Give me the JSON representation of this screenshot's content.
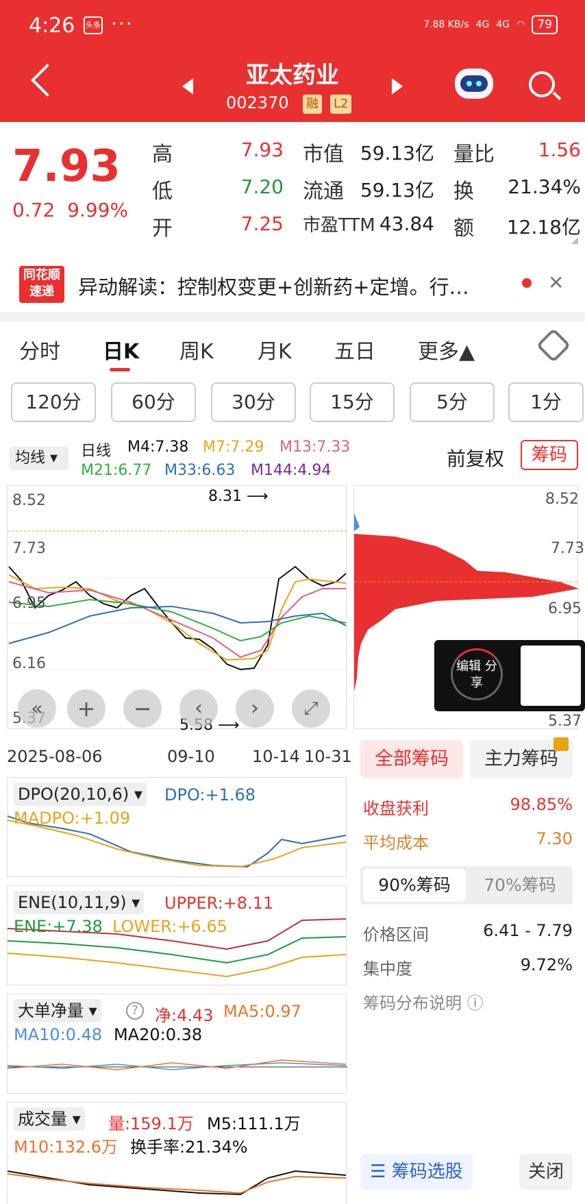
{
  "status_bar": {
    "time": "4:26",
    "app_icon": "头条",
    "dots": "···",
    "net_speed": "7.88 KB/s",
    "net1": "4G",
    "net2": "4G",
    "battery": "79"
  },
  "header": {
    "title": "亚太药业",
    "code": "002370",
    "tag_margin": "融",
    "tag_level": "L2"
  },
  "quote": {
    "price": "7.93",
    "change": "0.72",
    "change_pct": "9.99%",
    "high_label": "高",
    "high": "7.93",
    "low_label": "低",
    "low": "7.20",
    "open_label": "开",
    "open": "7.25",
    "mktcap_label": "市值",
    "mktcap": "59.13亿",
    "float_label": "流通",
    "float": "59.13亿",
    "pe_label": "市盈TTM",
    "pe": "43.84",
    "vol_ratio_label": "量比",
    "vol_ratio": "1.56",
    "turnover_label": "换",
    "turnover": "21.34%",
    "amount_label": "额",
    "amount": "12.18亿"
  },
  "news": {
    "logo": "同花顺 速递",
    "text": "异动解读：控制权变更+创新药+定增。行…"
  },
  "tabs": [
    "分时",
    "日K",
    "周K",
    "月K",
    "五日",
    "更多▲"
  ],
  "periods": [
    "120分",
    "60分",
    "30分",
    "15分",
    "5分",
    "1分"
  ],
  "ma": {
    "selector": "均线",
    "kind": "日线",
    "m4": "M4:7.38",
    "m7": "M7:7.29",
    "m13": "M13:7.33",
    "m21": "M21:6.77",
    "m33": "M33:6.63",
    "m144": "M144:4.94",
    "adjust": "前复权",
    "chips_btn": "筹码"
  },
  "kline": {
    "y_labels": [
      "8.52",
      "7.73",
      "6.95",
      "6.16",
      "5.37"
    ],
    "high_mark": "8.31",
    "low_mark": "5.58",
    "dates": [
      "2025-08-06",
      "09-10",
      "10-14",
      "10-31"
    ]
  },
  "indicators": {
    "dpo": {
      "name": "DPO(20,10,6)",
      "dpo": "DPO:+1.68",
      "madpo": "MADPO:+1.09"
    },
    "ene": {
      "name": "ENE(10,11,9)",
      "upper": "UPPER:+8.11",
      "ene": "ENE:+7.38",
      "lower": "LOWER:+6.65"
    },
    "big": {
      "name": "大单净量",
      "net": "净:4.43",
      "ma5": "MA5:0.97",
      "ma10": "MA10:0.48",
      "ma20": "MA20:0.38"
    },
    "vol": {
      "name": "成交量",
      "vol": "量:159.1万",
      "m5": "M5:111.1万",
      "m10": "M10:132.6万",
      "hs": "换手率:21.34%"
    }
  },
  "chips": {
    "tab_all": "全部筹码",
    "tab_main": "主力筹码",
    "profit_label": "收盘获利",
    "profit": "98.85%",
    "avg_label": "平均成本",
    "avg": "7.30",
    "seg_90": "90%筹码",
    "seg_70": "70%筹码",
    "range_label": "价格区间",
    "range": "6.41 - 7.79",
    "conc_label": "集中度",
    "conc": "9.72%",
    "help": "筹码分布说明",
    "select_btn": "筹码选股",
    "close_btn": "关闭"
  },
  "popup": {
    "label": "编辑 分享"
  },
  "colors": {
    "accent": "#e93030",
    "up": "#e93030",
    "down": "#1a9b3a"
  }
}
